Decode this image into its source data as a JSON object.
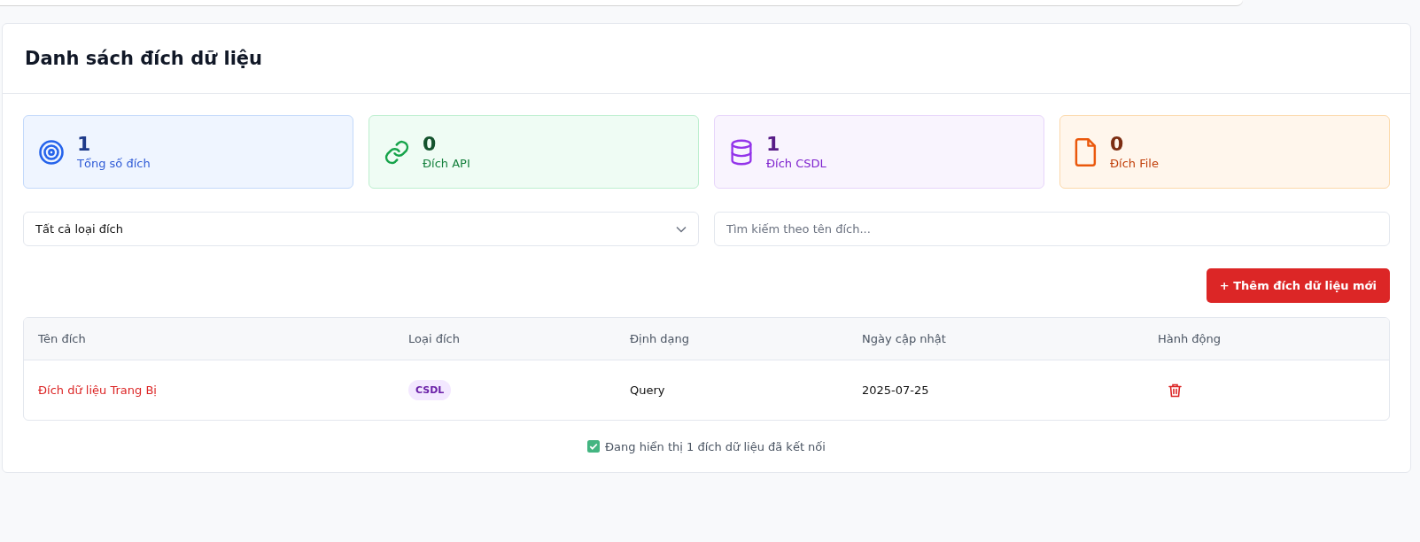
{
  "title": "Danh sách đích dữ liệu",
  "stats": [
    {
      "kind": "target",
      "value": "1",
      "label": "Tổng số đích"
    },
    {
      "kind": "link",
      "value": "0",
      "label": "Đích API"
    },
    {
      "kind": "database",
      "value": "1",
      "label": "Đích CSDL"
    },
    {
      "kind": "file",
      "value": "0",
      "label": "Đích File"
    }
  ],
  "filters": {
    "type_select": {
      "value": "Tất cả loại đích"
    },
    "search": {
      "placeholder": "Tìm kiếm theo tên đích..."
    }
  },
  "add_button": "+ Thêm đích dữ liệu mới",
  "table": {
    "columns": [
      "Tên đích",
      "Loại đích",
      "Định dạng",
      "Ngày cập nhật",
      "Hành động"
    ],
    "rows": [
      {
        "name": "Đích dữ liệu Trang Bị",
        "type": "CSDL",
        "format": "Query",
        "updated": "2025-07-25"
      }
    ]
  },
  "footer": "Đang hiển thị 1 đích dữ liệu đã kết nối"
}
